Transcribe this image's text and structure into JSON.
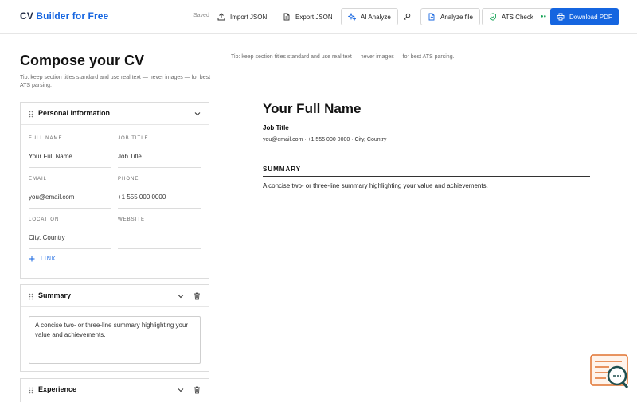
{
  "header": {
    "brand_part1": "CV",
    "brand_part2": "Builder",
    "brand_part3": "for Free",
    "saved": "Saved",
    "import_label": "Import JSON",
    "export_label": "Export JSON",
    "ai_label": "AI Analyze",
    "analyze_file_label": "Analyze file",
    "ats_label": "ATS Check",
    "ats_dots": "",
    "download_label": "Download PDF"
  },
  "left": {
    "title": "Compose your CV",
    "tip": "Tip: keep section titles standard and use real text — never images — for best ATS parsing."
  },
  "personal": {
    "title": "Personal Information",
    "full_name_label": "FULL NAME",
    "full_name_value": "Your Full Name",
    "job_title_label": "JOB TITLE",
    "job_title_value": "Job Title",
    "email_label": "EMAIL",
    "email_value": "you@email.com",
    "phone_label": "PHONE",
    "phone_value": "+1 555 000 0000",
    "location_label": "LOCATION",
    "location_value": "City, Country",
    "website_label": "WEBSITE",
    "website_value": "",
    "add_link": "LINK"
  },
  "summary": {
    "title": "Summary",
    "text": "A concise two- or three-line summary highlighting your value and achievements."
  },
  "experience": {
    "title": "Experience"
  },
  "preview": {
    "tip": "Tip: keep section titles standard and use real text — never images — for best ATS parsing.",
    "name": "Your Full Name",
    "job_title": "Job Title",
    "contact": "you@email.com · +1 555 000 0000 · City, Country",
    "summary_heading": "SUMMARY",
    "summary_text": "A concise two- or three-line summary highlighting your value and achievements."
  },
  "colors": {
    "accent": "#1565e0",
    "text": "#111111",
    "widget": "#e0722f"
  }
}
